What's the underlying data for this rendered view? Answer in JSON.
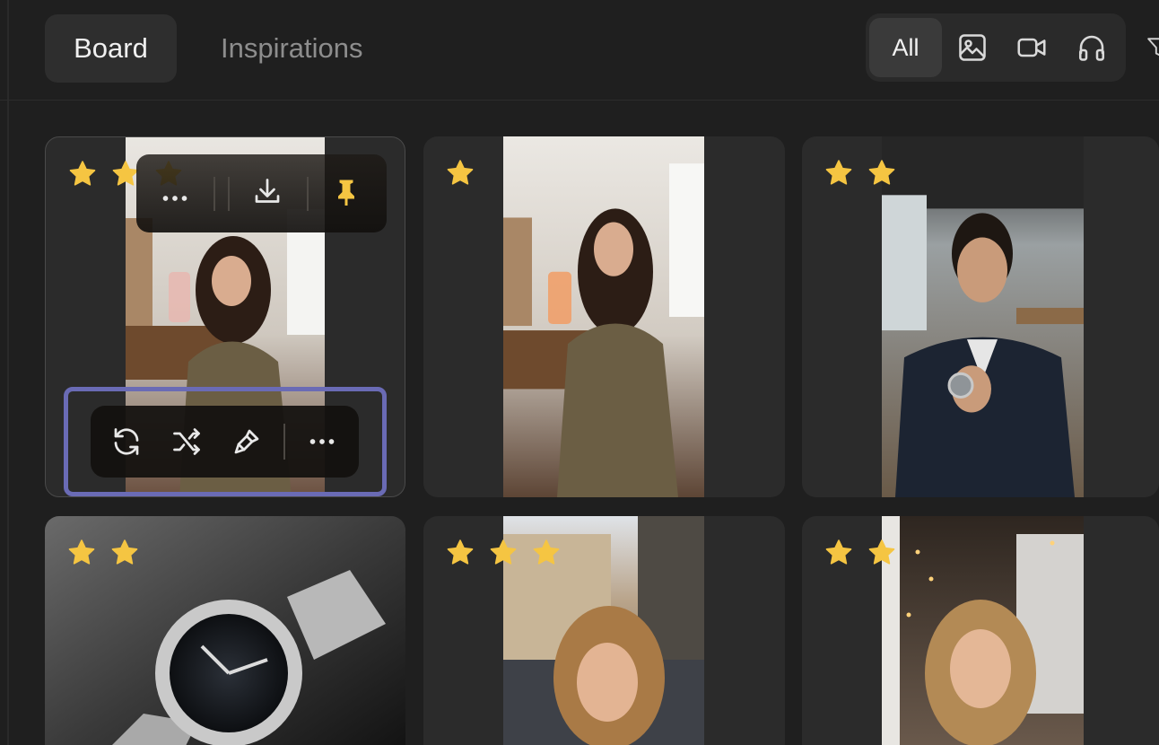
{
  "tabs": [
    {
      "label": "Board",
      "active": true
    },
    {
      "label": "Inspirations",
      "active": false
    }
  ],
  "filters": {
    "all_label": "All",
    "icons": [
      "image-icon",
      "video-icon",
      "audio-icon",
      "filter-icon"
    ]
  },
  "colors": {
    "background": "#1f1f1f",
    "card": "#2b2b2b",
    "star": "#f5c542",
    "selection_outline": "#6a6bb5"
  },
  "cards": [
    {
      "stars": 3,
      "subject": "woman holding perfume bottle at vanity",
      "selected": true,
      "hover_toolbar_top": [
        "more-icon",
        "download-icon",
        "pin-icon"
      ],
      "hover_toolbar_bottom": [
        "regenerate-icon",
        "shuffle-icon",
        "brush-icon",
        "more-icon"
      ]
    },
    {
      "stars": 1,
      "subject": "woman holding perfume bottle at vanity"
    },
    {
      "stars": 2,
      "subject": "man in suit showing wristwatch in office"
    },
    {
      "stars": 2,
      "subject": "steel wristwatch on slate"
    },
    {
      "stars": 3,
      "subject": "woman at Paris street cafe"
    },
    {
      "stars": 2,
      "subject": "woman in cafe with string lights"
    }
  ]
}
